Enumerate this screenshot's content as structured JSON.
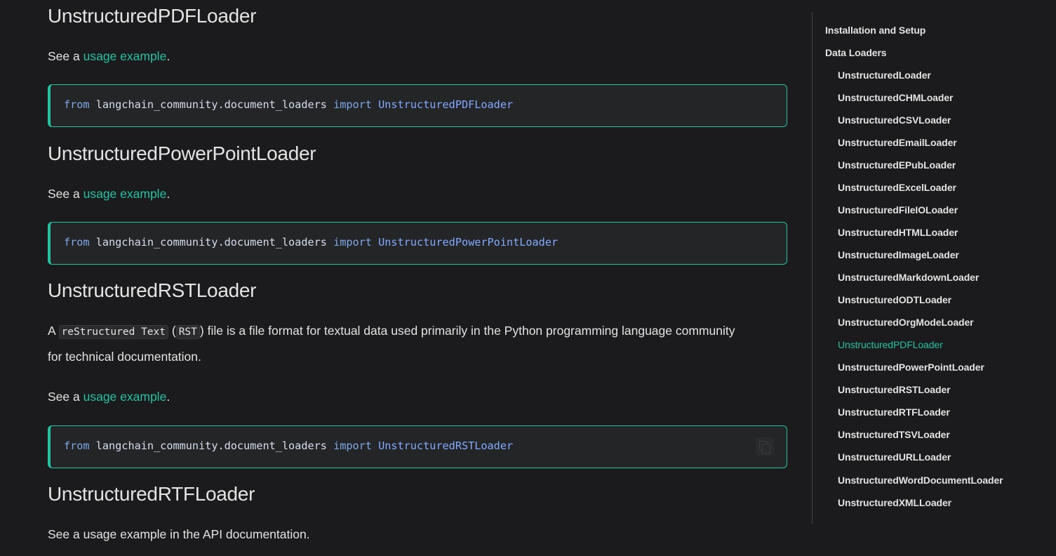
{
  "sections": [
    {
      "heading": "UnstructuredPDFLoader",
      "see_prefix": "See a ",
      "see_link": "usage example",
      "see_suffix": ".",
      "code": {
        "from": "from",
        "module": "langchain_community.document_loaders",
        "import": "import",
        "cls": "UnstructuredPDFLoader"
      }
    },
    {
      "heading": "UnstructuredPowerPointLoader",
      "see_prefix": "See a ",
      "see_link": "usage example",
      "see_suffix": ".",
      "code": {
        "from": "from",
        "module": "langchain_community.document_loaders",
        "import": "import",
        "cls": "UnstructuredPowerPointLoader"
      }
    },
    {
      "heading": "UnstructuredRSTLoader",
      "desc_prefix": "A ",
      "desc_code1": "reStructured Text",
      "desc_code2": "RST",
      "desc_line1_rest": " file is a file format for textual data used primarily in the Python programming language community",
      "desc_line2": "for technical documentation.",
      "see_prefix": "See a ",
      "see_link": "usage example",
      "see_suffix": ".",
      "code": {
        "from": "from",
        "module": "langchain_community.document_loaders",
        "import": "import",
        "cls": "UnstructuredRSTLoader"
      }
    },
    {
      "heading": "UnstructuredRTFLoader",
      "see_text": "See a usage example in the API documentation."
    }
  ],
  "toc": {
    "items": [
      {
        "label": "Installation and Setup",
        "level": 1,
        "active": false
      },
      {
        "label": "Data Loaders",
        "level": 1,
        "active": false
      },
      {
        "label": "UnstructuredLoader",
        "level": 2,
        "active": false
      },
      {
        "label": "UnstructuredCHMLoader",
        "level": 2,
        "active": false
      },
      {
        "label": "UnstructuredCSVLoader",
        "level": 2,
        "active": false
      },
      {
        "label": "UnstructuredEmailLoader",
        "level": 2,
        "active": false
      },
      {
        "label": "UnstructuredEPubLoader",
        "level": 2,
        "active": false
      },
      {
        "label": "UnstructuredExcelLoader",
        "level": 2,
        "active": false
      },
      {
        "label": "UnstructuredFileIOLoader",
        "level": 2,
        "active": false
      },
      {
        "label": "UnstructuredHTMLLoader",
        "level": 2,
        "active": false
      },
      {
        "label": "UnstructuredImageLoader",
        "level": 2,
        "active": false
      },
      {
        "label": "UnstructuredMarkdownLoader",
        "level": 2,
        "active": false
      },
      {
        "label": "UnstructuredODTLoader",
        "level": 2,
        "active": false
      },
      {
        "label": "UnstructuredOrgModeLoader",
        "level": 2,
        "active": false
      },
      {
        "label": "UnstructuredPDFLoader",
        "level": 2,
        "active": true
      },
      {
        "label": "UnstructuredPowerPointLoader",
        "level": 2,
        "active": false
      },
      {
        "label": "UnstructuredRSTLoader",
        "level": 2,
        "active": false
      },
      {
        "label": "UnstructuredRTFLoader",
        "level": 2,
        "active": false
      },
      {
        "label": "UnstructuredTSVLoader",
        "level": 2,
        "active": false
      },
      {
        "label": "UnstructuredURLLoader",
        "level": 2,
        "active": false
      },
      {
        "label": "UnstructuredWordDocumentLoader",
        "level": 2,
        "active": false
      },
      {
        "label": "UnstructuredXMLLoader",
        "level": 2,
        "active": false
      }
    ]
  },
  "colors": {
    "accent": "#25c2a0",
    "background": "#1b1b1d",
    "code_bg": "#242526"
  },
  "icons": {
    "copy": "copy-icon"
  }
}
